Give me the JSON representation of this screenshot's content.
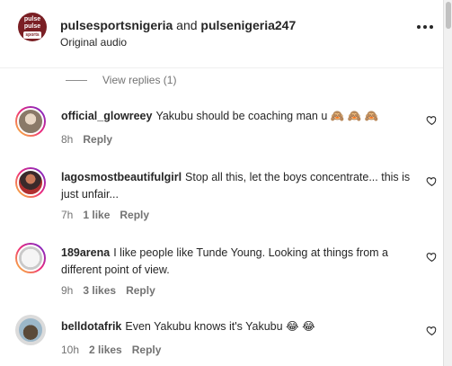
{
  "header": {
    "account_a": "pulsesportsnigeria",
    "and_text": " and ",
    "account_b": "pulsenigeria247",
    "subtitle": "Original audio",
    "brand_top": "pulse",
    "brand_mid": "pulse",
    "brand_sub": "sports"
  },
  "view_replies": "View replies (1)",
  "comments": [
    {
      "user": "official_glowreey",
      "text": "Yakubu should be coaching man u 🙈 🙈 🙈",
      "time": "8h",
      "likes": "",
      "reply": "Reply"
    },
    {
      "user": "lagosmostbeautifulgirl",
      "text": "Stop all this, let the boys concentrate... this is just unfair...",
      "time": "7h",
      "likes": "1 like",
      "reply": "Reply"
    },
    {
      "user": "189arena",
      "text": "I like people like Tunde Young. Looking at things from a different point of view.",
      "time": "9h",
      "likes": "3 likes",
      "reply": "Reply"
    },
    {
      "user": "belldotafrik",
      "text": "Even Yakubu knows it's Yakubu 😂 😂",
      "time": "10h",
      "likes": "2 likes",
      "reply": "Reply"
    }
  ],
  "colors": {
    "muted": "#737373",
    "text": "#262626",
    "brand": "#7a1f24"
  }
}
